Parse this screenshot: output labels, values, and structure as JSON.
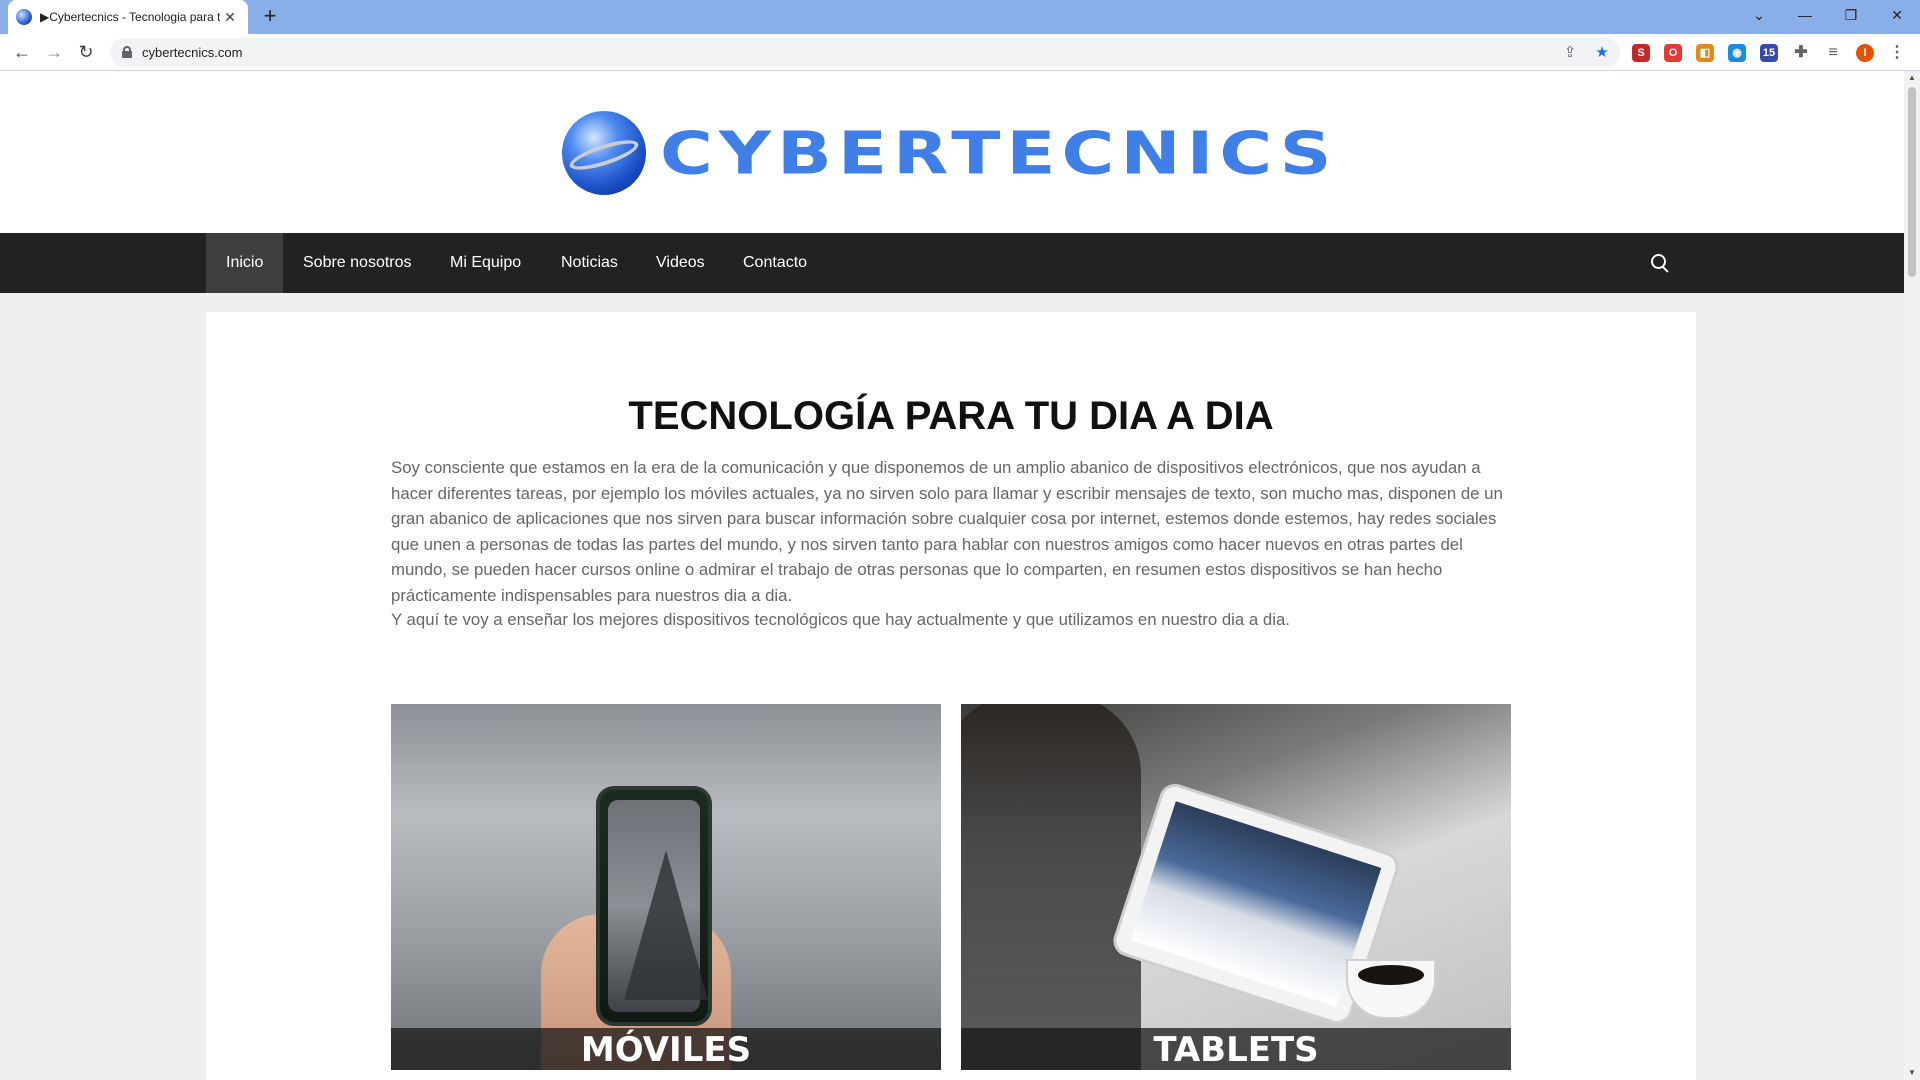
{
  "browser": {
    "tab_title": "▶Cybertecnics - Tecnologia para tu dia a dia",
    "tab_close": "✕",
    "new_tab": "+",
    "url": "cybertecnics.com",
    "window_controls": {
      "dropdown": "⌄",
      "minimize": "—",
      "restore": "❐",
      "close": "✕"
    },
    "nav": {
      "back": "←",
      "forward": "→",
      "reload": "↻"
    },
    "omnibox_icons": {
      "share": "⇪",
      "bookmark": "★"
    },
    "extensions": [
      {
        "name": "red-extension-icon",
        "glyph": "S",
        "color": "#c62828"
      },
      {
        "name": "opera-extension-icon",
        "glyph": "O",
        "color": "#e53935"
      },
      {
        "name": "orange-extension-icon",
        "glyph": "◧",
        "color": "#e08a1e"
      },
      {
        "name": "blue-extension-icon",
        "glyph": "◉",
        "color": "#1e88e5"
      },
      {
        "name": "badge-extension-icon",
        "glyph": "15",
        "color": "#3949ab"
      },
      {
        "name": "puzzle-extension-icon",
        "glyph": "✚",
        "color": "#5f6368"
      },
      {
        "name": "media-extension-icon",
        "glyph": "≡",
        "color": "#5f6368"
      },
      {
        "name": "profile-avatar",
        "glyph": "I",
        "color": "#e65100"
      },
      {
        "name": "menu-icon",
        "glyph": "⋮",
        "color": "#5f6368"
      }
    ]
  },
  "site": {
    "logo_text": "CYBERTECNICS",
    "nav": [
      "Inicio",
      "Sobre nosotros",
      "Mi Equipo",
      "Noticias",
      "Videos",
      "Contacto"
    ],
    "active_nav": "Inicio"
  },
  "main": {
    "heading": "TECNOLOGÍA PARA TU DIA A DIA",
    "paragraph1": "Soy consciente que estamos en la era de la comunicación y que disponemos de un amplio abanico de dispositivos electrónicos, que nos ayudan a hacer diferentes tareas, por ejemplo los móviles actuales, ya no sirven solo para llamar y escribir mensajes de texto, son mucho mas, disponen de un gran abanico de aplicaciones que nos sirven para buscar información sobre cualquier cosa por internet, estemos donde estemos, hay redes sociales que unen a personas de todas las partes del mundo, y nos sirven tanto para hablar con nuestros amigos como hacer nuevos en otras partes del mundo, se pueden hacer cursos online o admirar el trabajo de otras personas que lo comparten, en resumen estos dispositivos se han hecho prácticamente indispensables para nuestros dia a dia.",
    "paragraph2": "Y aquí te voy a enseñar los mejores dispositivos tecnológicos que hay actualmente y que utilizamos en nuestro dia a dia.",
    "cards": [
      {
        "label": "MÓVILES"
      },
      {
        "label": "TABLETS"
      }
    ]
  }
}
